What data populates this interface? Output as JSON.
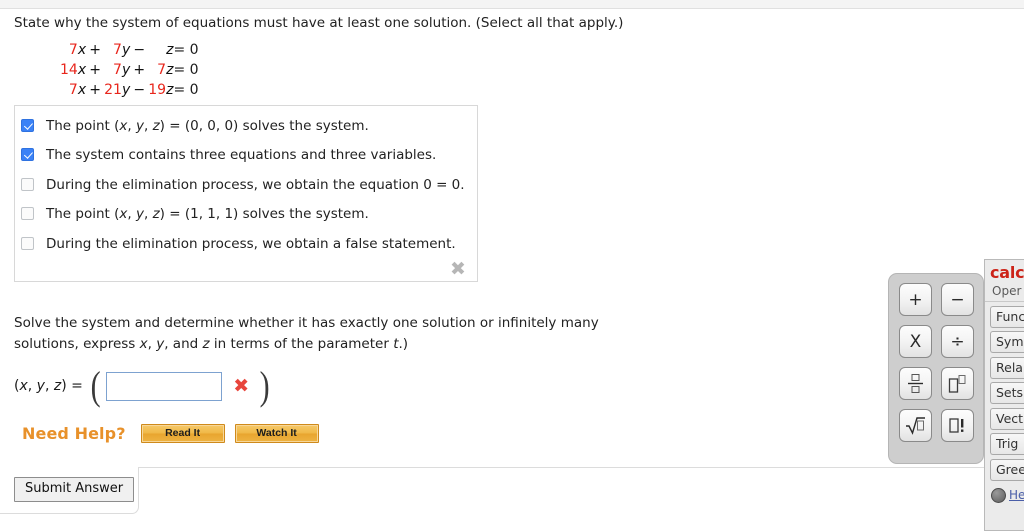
{
  "question1": {
    "text": "State why the system of equations must have at least one solution. (Select all that apply.)"
  },
  "equations": [
    {
      "c1": "7",
      "v1": "x",
      "op1": "+",
      "c2": "7",
      "v2": "y",
      "op2": "−",
      "c3": "",
      "v3": "z",
      "eq": "=",
      "rhs": "0"
    },
    {
      "c1": "14",
      "v1": "x",
      "op1": "+",
      "c2": "7",
      "v2": "y",
      "op2": "+",
      "c3": "7",
      "v3": "z",
      "eq": "=",
      "rhs": "0"
    },
    {
      "c1": "7",
      "v1": "x",
      "op1": "+",
      "c2": "21",
      "v2": "y",
      "op2": "−",
      "c3": "19",
      "v3": "z",
      "eq": "=",
      "rhs": "0"
    }
  ],
  "choices": [
    {
      "label": "The point (x, y, z) = (0, 0, 0) solves the system.",
      "checked": true
    },
    {
      "label": "The system contains three equations and three variables.",
      "checked": true
    },
    {
      "label": "During the elimination process, we obtain the equation 0 = 0.",
      "checked": false
    },
    {
      "label": "The point (x, y, z) = (1, 1, 1) solves the system.",
      "checked": false
    },
    {
      "label": "During the elimination process, we obtain a false statement.",
      "checked": false
    }
  ],
  "choice_group_clear": "✖",
  "question2": {
    "text": "Solve the system and determine whether it has exactly one solution or infinitely many solutions. (If the system has an infinite number of solutions, express x, y, and z in terms of the parameter t.)"
  },
  "answer": {
    "lhs": "(x, y, z) = ",
    "open_paren": "(",
    "close_paren": ")",
    "value": "",
    "placeholder": "",
    "incorrect_mark": "✖"
  },
  "need_help": {
    "label": "Need Help?",
    "buttons": [
      "Read It",
      "Watch It"
    ]
  },
  "submit": {
    "label": "Submit Answer"
  },
  "keypad": {
    "buttons": [
      {
        "name": "plus",
        "glyph": "+"
      },
      {
        "name": "minus",
        "glyph": "−"
      },
      {
        "name": "multiply",
        "glyph": "X"
      },
      {
        "name": "divide",
        "glyph": "÷"
      },
      {
        "name": "fraction",
        "glyph": ""
      },
      {
        "name": "exponent",
        "glyph": ""
      },
      {
        "name": "square-root",
        "glyph": ""
      },
      {
        "name": "factorial",
        "glyph": ""
      }
    ]
  },
  "calcpad": {
    "title": "calc",
    "subtitle": "Oper",
    "items": [
      "Func",
      "Syml",
      "Rela",
      "Sets",
      "Vect",
      "Trig",
      "Gree"
    ],
    "help_link": "He"
  },
  "colors": {
    "coefficient_red": "#e8261c",
    "checkbox_blue": "#3b82f6",
    "need_help_orange": "#e8912a",
    "incorrect_red": "#e8453c",
    "calcpad_red": "#cc2318"
  }
}
